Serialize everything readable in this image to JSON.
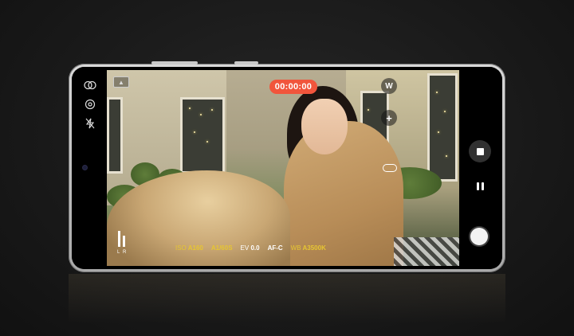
{
  "viewfinder": {
    "timer": "00:00:00",
    "zoom_label": "W",
    "zoom_plus": "+"
  },
  "info_bar": {
    "iso_key": "ISO",
    "iso_val": "A160",
    "shutter_val": "A1/60S",
    "ev_key": "EV",
    "ev_val": "0.0",
    "focus_val": "AF-C",
    "wb_key": "WB",
    "wb_val": "A3500K"
  },
  "audio_meter": {
    "left_label": "L",
    "right_label": "R"
  },
  "colors": {
    "record_timer": "#f1553c",
    "info_accent": "#e6c532"
  },
  "icons": {
    "lens_select": "double-circle-icon",
    "stabilization": "ois-icon",
    "flash": "flash-off-icon",
    "aspect_ratio": "mountain-icon",
    "stop": "stop-icon",
    "pause": "pause-icon",
    "capture": "shutter-icon"
  }
}
